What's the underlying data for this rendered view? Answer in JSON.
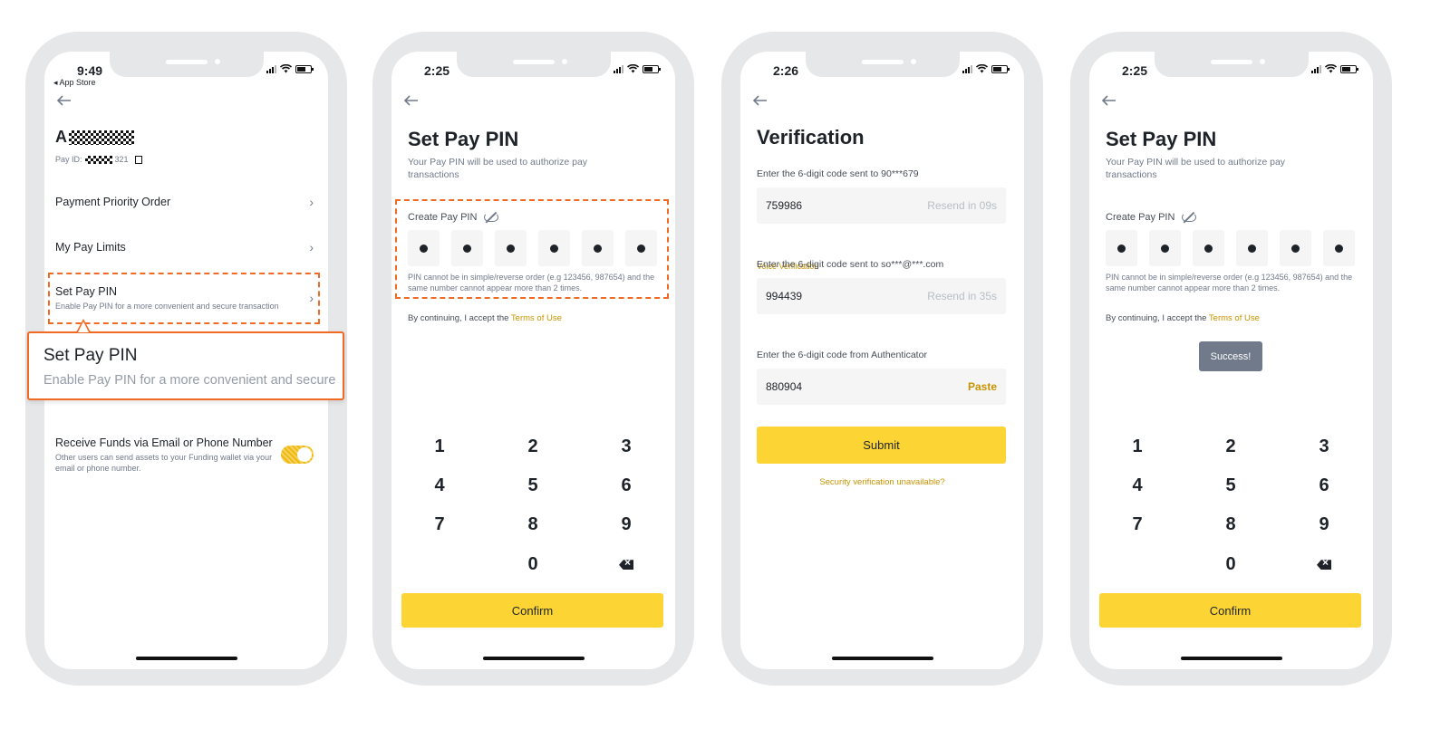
{
  "screen1": {
    "time": "9:49",
    "back_app": "◂ App Store",
    "account_initial": "A",
    "payid_prefix": "Pay ID:",
    "payid_suffix": "321",
    "menu": [
      {
        "label": "Payment Priority Order"
      },
      {
        "label": "My Pay Limits"
      },
      {
        "label": "Set Pay PIN",
        "sub": "Enable Pay PIN for a more convenient and secure transaction"
      },
      {
        "label": "Receive Funds via Email or Phone Number",
        "sub": "Other users can send assets to your Funding wallet via your email or phone number."
      }
    ],
    "toggle_on": true,
    "callout_title": "Set Pay PIN",
    "callout_sub": "Enable Pay PIN for a more convenient and secure"
  },
  "screen2": {
    "time": "2:25",
    "title": "Set Pay PIN",
    "subtitle": "Your Pay PIN will be used to authorize pay transactions",
    "pin_label": "Create Pay PIN",
    "pin_hint": "PIN cannot be in simple/reverse order (e.g 123456, 987654) and the same number cannot appear more than 2 times.",
    "terms_prefix": "By continuing, I accept the",
    "terms_link": "Terms of Use",
    "keys": [
      "1",
      "2",
      "3",
      "4",
      "5",
      "6",
      "7",
      "8",
      "9",
      "0"
    ],
    "confirm": "Confirm"
  },
  "screen3": {
    "time": "2:26",
    "title": "Verification",
    "phone_label": "Enter the 6-digit code sent to 90***679",
    "phone_code": "759986",
    "phone_resend": "Resend in 09s",
    "voice": "Voice Verification",
    "email_label": "Enter the 6-digit code sent to so***@***.com",
    "email_code": "994439",
    "email_resend": "Resend in 35s",
    "auth_label": "Enter the 6-digit code from Authenticator",
    "auth_code": "880904",
    "paste": "Paste",
    "submit": "Submit",
    "unavailable": "Security verification unavailable?"
  },
  "screen4": {
    "time": "2:25",
    "title": "Set Pay PIN",
    "subtitle": "Your Pay PIN will be used to authorize pay transactions",
    "pin_label": "Create Pay PIN",
    "pin_hint": "PIN cannot be in simple/reverse order (e.g 123456, 987654) and the same number cannot appear more than 2 times.",
    "terms_prefix": "By continuing, I accept the",
    "terms_link": "Terms of Use",
    "toast": "Success!",
    "keys": [
      "1",
      "2",
      "3",
      "4",
      "5",
      "6",
      "7",
      "8",
      "9",
      "0"
    ],
    "confirm": "Confirm"
  },
  "colors": {
    "accent_yellow": "#fcd535",
    "link_gold": "#c99400",
    "highlight_orange": "#f06a23",
    "frame_gray": "#e6e7e9"
  }
}
